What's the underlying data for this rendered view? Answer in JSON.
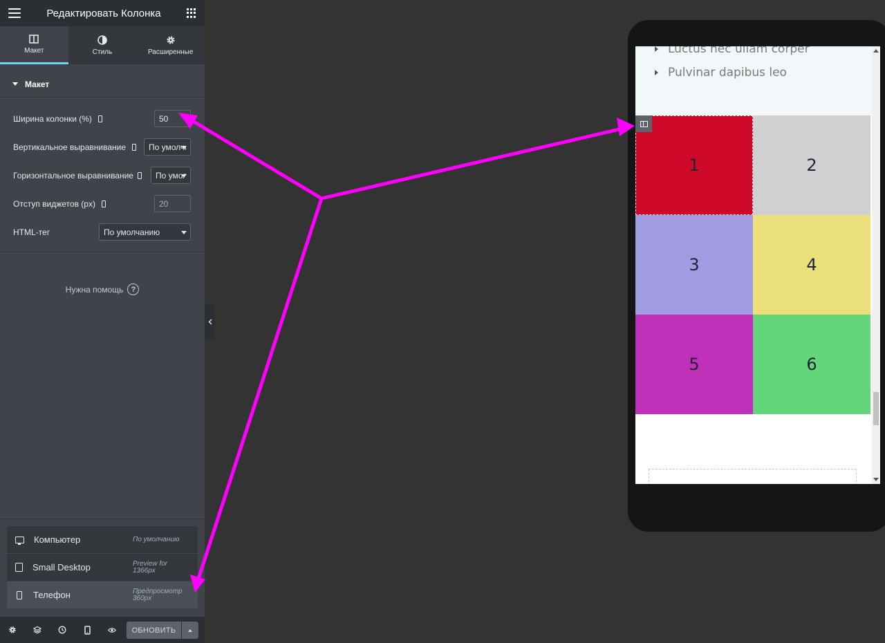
{
  "header": {
    "title": "Редактировать Колонка",
    "menu_icon": "hamburger-icon",
    "apps_icon": "apps-grid-icon"
  },
  "tabs": [
    {
      "label": "Макет",
      "icon": "columns-icon",
      "active": true
    },
    {
      "label": "Стиль",
      "icon": "contrast-icon",
      "active": false
    },
    {
      "label": "Расширенные",
      "icon": "gear-icon",
      "active": false
    }
  ],
  "section": {
    "title": "Макет"
  },
  "controls": {
    "column_width": {
      "label": "Ширина колонки (%)",
      "value": "50"
    },
    "vertical_align": {
      "label": "Вертикальное выравнивание",
      "value": "По умолчанию"
    },
    "horizontal_align": {
      "label": "Горизонтальное выравнивание",
      "value": "По умолчанию"
    },
    "widget_spacing": {
      "label": "Отступ виджетов (px)",
      "placeholder": "20"
    },
    "html_tag": {
      "label": "HTML-тег",
      "value": "По умолчанию"
    }
  },
  "help": {
    "label": "Нужна помощь",
    "icon_glyph": "?"
  },
  "devices": [
    {
      "name": "Компьютер",
      "note": "По умолчанию",
      "icon": "desktop-icon",
      "active": false
    },
    {
      "name": "Small Desktop",
      "note": "Preview for 1366px",
      "icon": "tablet-icon",
      "active": false
    },
    {
      "name": "Телефон",
      "note": "Предпросмотр 360px",
      "icon": "phone-icon",
      "active": true
    }
  ],
  "footer": {
    "update_label": "ОБНОВИТЬ"
  },
  "preview": {
    "list_items": [
      "Luctus nec ullam corper",
      "Pulvinar dapibus leo"
    ],
    "cells": [
      {
        "label": "1",
        "color": "#cf0a29"
      },
      {
        "label": "2",
        "color": "#d0d0d0"
      },
      {
        "label": "3",
        "color": "#a09be3"
      },
      {
        "label": "4",
        "color": "#ece07c"
      },
      {
        "label": "5",
        "color": "#be31b8"
      },
      {
        "label": "6",
        "color": "#64d57b"
      }
    ]
  },
  "colors": {
    "accent_tab": "#71d7f7",
    "annotation_arrow": "#ff00ff",
    "panel_bg": "#404349"
  }
}
